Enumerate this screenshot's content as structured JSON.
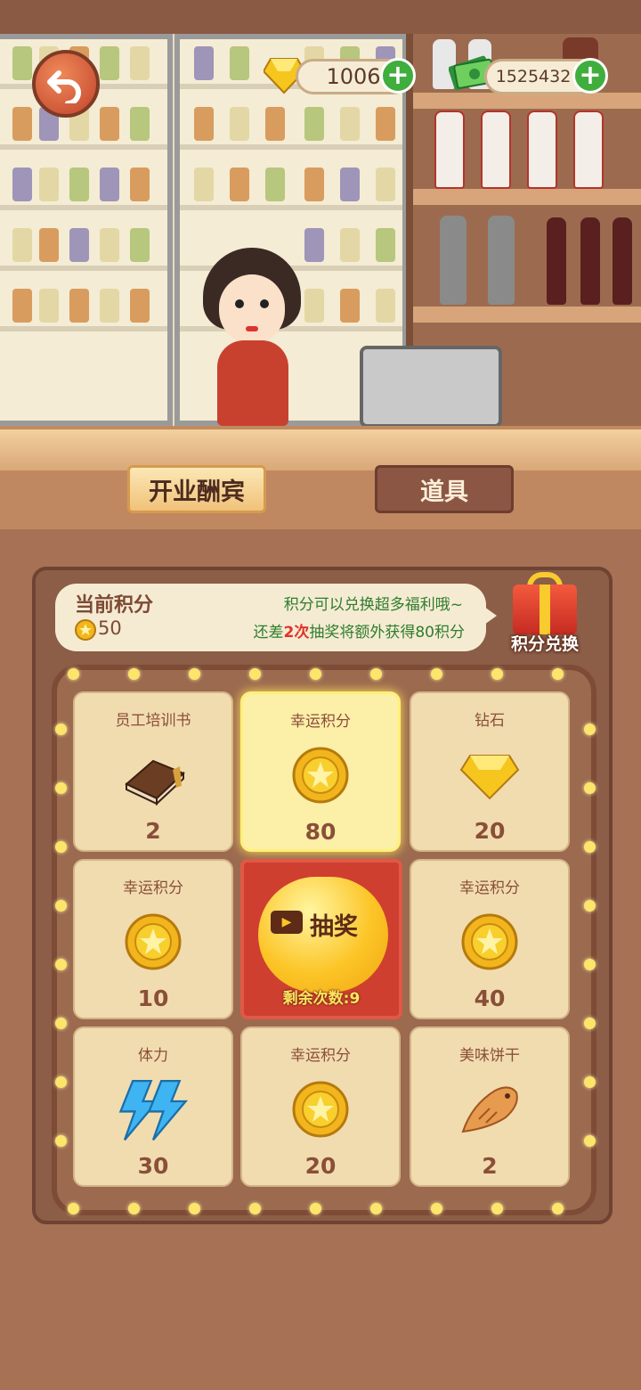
{
  "hud": {
    "diamonds": "1006",
    "cash": "1525432"
  },
  "tabs": [
    {
      "label": "开业酬宾",
      "selected": true
    },
    {
      "label": "道具",
      "selected": false
    }
  ],
  "points_panel": {
    "title": "当前积分",
    "points": "50",
    "tip": "积分可以兑换超多福利哦~",
    "remain_prefix": "还差",
    "remain_count": "2次",
    "remain_suffix": "抽奖将额外获得80积分",
    "exchange_label": "积分兑换"
  },
  "prizes": [
    {
      "name": "员工培训书",
      "qty": "2",
      "icon": "book-icon"
    },
    {
      "name": "幸运积分",
      "qty": "80",
      "icon": "coin-icon",
      "active": true
    },
    {
      "name": "钻石",
      "qty": "20",
      "icon": "diamond-icon"
    },
    {
      "name": "幸运积分",
      "qty": "10",
      "icon": "coin-icon"
    },
    {
      "name": "幸运积分",
      "qty": "40",
      "icon": "coin-icon"
    },
    {
      "name": "体力",
      "qty": "30",
      "icon": "lightning-icon"
    },
    {
      "name": "幸运积分",
      "qty": "20",
      "icon": "coin-icon"
    },
    {
      "name": "美味饼干",
      "qty": "2",
      "icon": "fish-cookie-icon"
    }
  ],
  "draw": {
    "label": "抽奖",
    "remaining": "剩余次数:9"
  },
  "colors": {
    "accent_green": "#3fae3d",
    "panel_brown": "#8c5d47",
    "draw_red": "#cf3f2f",
    "gold": "#fcc527"
  }
}
